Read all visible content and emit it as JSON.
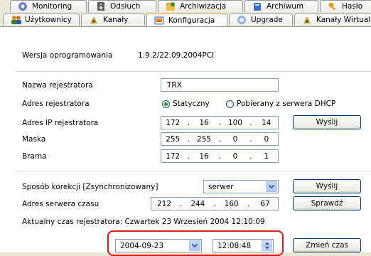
{
  "tabs_row1": [
    {
      "label": "Monitoring",
      "icon": "monitoring-icon"
    },
    {
      "label": "Odsłuch",
      "icon": "speaker-icon"
    },
    {
      "label": "Archiwizacja",
      "icon": "folder-archive-icon"
    },
    {
      "label": "Archiwum",
      "icon": "archive-icon"
    },
    {
      "label": "Hasło",
      "icon": "key-icon"
    }
  ],
  "tabs_row2": [
    {
      "label": "Użytkownicy",
      "icon": "users-icon"
    },
    {
      "label": "Kanały",
      "icon": "channels-icon"
    },
    {
      "label": "Konfiguracja",
      "icon": "configuration-icon",
      "active": true
    },
    {
      "label": "Upgrade",
      "icon": "upgrade-icon"
    },
    {
      "label": "Kanały Wirtualne",
      "icon": "virtual-channels-icon"
    }
  ],
  "firmware": {
    "label": "Wersja oprogramowania",
    "value": "1.9.2/22.09.2004PCI"
  },
  "recorder_name": {
    "label": "Nazwa rejestratora",
    "value": "TRX"
  },
  "address": {
    "label": "Adres rejestratora",
    "option_static": "Statyczny",
    "option_dhcp": "Pobierany z serwera DHCP"
  },
  "ip": {
    "label": "Adres IP rejestratora",
    "octets": [
      "172",
      "16",
      "100",
      "14"
    ]
  },
  "mask": {
    "label": "Maska",
    "octets": [
      "255",
      "255",
      "0",
      "0"
    ]
  },
  "gateway": {
    "label": "Brama",
    "octets": [
      "172",
      "16",
      "0",
      "1"
    ]
  },
  "send_label": "Wyślij",
  "sync": {
    "label": "Sposób korekcji [Zsynchronizowany]",
    "value": "serwer",
    "button": "Wyślij"
  },
  "time_server": {
    "label": "Adres serwera czasu",
    "octets": [
      "212",
      "244",
      "160",
      "67"
    ],
    "button": "Sprawdź"
  },
  "current_time": {
    "text": "Aktualny czas rejestratora: Czwartek 23 Wrzesień 2004 12:10:09"
  },
  "set_time": {
    "date": "2004-09-23",
    "time": "12:08:48",
    "button": "Zmień czas"
  },
  "colors": {
    "highlight": "#e0151b",
    "active_tab": "#f0a02e"
  }
}
